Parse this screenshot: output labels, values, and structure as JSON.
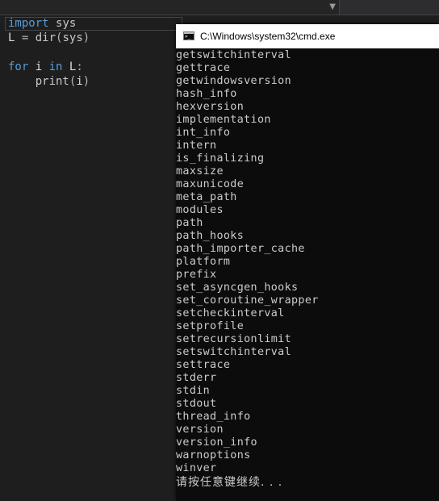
{
  "editor": {
    "lines": [
      {
        "tokens": [
          {
            "text": "import",
            "kind": "kw"
          },
          {
            "text": " "
          },
          {
            "text": "sys",
            "kind": "mod"
          }
        ]
      },
      {
        "tokens": [
          {
            "text": "L",
            "kind": "var"
          },
          {
            "text": " = ",
            "kind": "op"
          },
          {
            "text": "dir",
            "kind": "fn"
          },
          {
            "text": "(",
            "kind": "paren"
          },
          {
            "text": "sys",
            "kind": "mod"
          },
          {
            "text": ")",
            "kind": "paren"
          }
        ]
      },
      {
        "tokens": []
      },
      {
        "tokens": [
          {
            "text": "for",
            "kind": "kw"
          },
          {
            "text": " "
          },
          {
            "text": "i",
            "kind": "var"
          },
          {
            "text": " "
          },
          {
            "text": "in",
            "kind": "kw"
          },
          {
            "text": " "
          },
          {
            "text": "L",
            "kind": "var"
          },
          {
            "text": ":",
            "kind": "op"
          }
        ]
      },
      {
        "tokens": [
          {
            "text": "    "
          },
          {
            "text": "print",
            "kind": "fn"
          },
          {
            "text": "(",
            "kind": "paren"
          },
          {
            "text": "i",
            "kind": "var"
          },
          {
            "text": ")",
            "kind": "paren"
          }
        ]
      }
    ]
  },
  "cmd": {
    "title": "C:\\Windows\\system32\\cmd.exe",
    "output": [
      "getswitchinterval",
      "gettrace",
      "getwindowsversion",
      "hash_info",
      "hexversion",
      "implementation",
      "int_info",
      "intern",
      "is_finalizing",
      "maxsize",
      "maxunicode",
      "meta_path",
      "modules",
      "path",
      "path_hooks",
      "path_importer_cache",
      "platform",
      "prefix",
      "set_asyncgen_hooks",
      "set_coroutine_wrapper",
      "setcheckinterval",
      "setprofile",
      "setrecursionlimit",
      "setswitchinterval",
      "settrace",
      "stderr",
      "stdin",
      "stdout",
      "thread_info",
      "version",
      "version_info",
      "warnoptions",
      "winver"
    ],
    "prompt": "请按任意键继续. . ."
  },
  "icons": {
    "dropdown": "chevron-down-icon",
    "cmd": "console-icon"
  },
  "colors": {
    "editor_bg": "#1e1e1e",
    "keyword": "#569cd6",
    "cmd_bg": "#0c0c0c",
    "cmd_text": "#cccccc"
  }
}
